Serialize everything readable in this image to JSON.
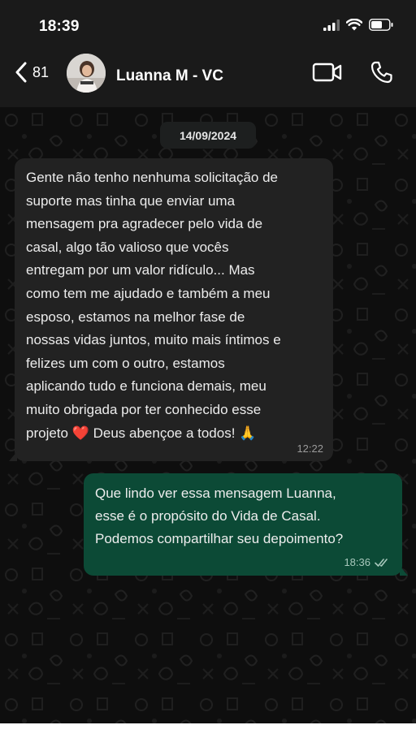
{
  "status_bar": {
    "time": "18:39"
  },
  "header": {
    "back_count": "81",
    "contact_name": "Luanna M - VC"
  },
  "chat": {
    "date": "14/09/2024",
    "messages": [
      {
        "direction": "incoming",
        "text": "Gente não tenho nenhuma solicitação de\nsuporte mas tinha que enviar uma\nmensagem pra agradecer pelo vida de\ncasal, algo tão valioso que vocês\nentregam por um valor ridículo... Mas\ncomo tem me ajudado e também a meu\nesposo, estamos na melhor fase de\nnossas vidas juntos, muito mais íntimos e\nfelizes um com o outro, estamos\naplicando tudo e funciona demais, meu\nmuito obrigada por ter conhecido esse\nprojeto ❤️ Deus abençoe a todos! 🙏",
        "time": "12:22"
      },
      {
        "direction": "outgoing",
        "text": "Que lindo ver essa mensagem Luanna,\nesse é o propósito do Vida de Casal.\nPodemos compartilhar seu depoimento?",
        "time": "18:36",
        "status_icon": "double-check-icon"
      }
    ]
  },
  "colors": {
    "outgoing_bubble": "#0c4a36",
    "incoming_bubble": "#222222",
    "header_bg": "#1a1a1a"
  }
}
